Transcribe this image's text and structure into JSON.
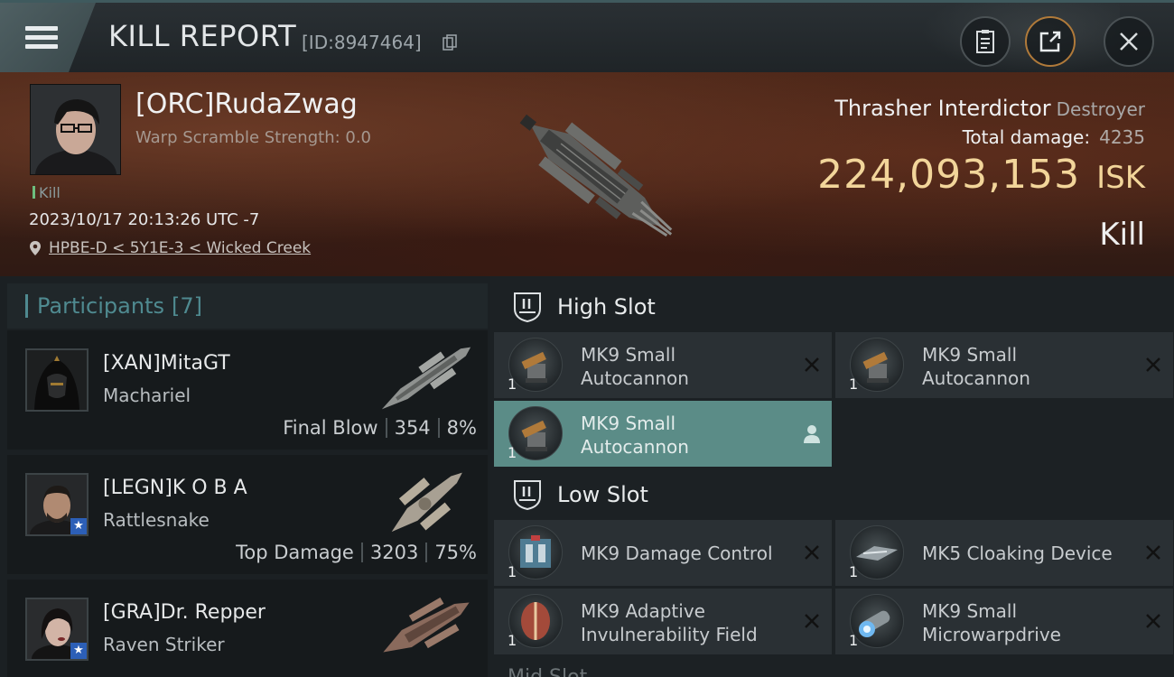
{
  "header": {
    "title": "KILL REPORT",
    "report_id": "[ID:8947464]",
    "icons": [
      "menu-icon",
      "copy-icon",
      "clipboard-icon",
      "share-icon",
      "close-icon"
    ]
  },
  "victim": {
    "pilot": "[ORC]RudaZwag",
    "subtitle": "Warp Scramble Strength: 0.0",
    "tag": "Kill",
    "timestamp": "2023/10/17 20:13:26 UTC -7",
    "location": "HPBE-D < 5Y1E-3 < Wicked Creek",
    "ship": "Thrasher Interdictor",
    "ship_class": "Destroyer",
    "total_damage_label": "Total damage:",
    "total_damage": "4235",
    "isk_value": "224,093,153",
    "isk_unit": "ISK",
    "result": "Kill"
  },
  "participants": {
    "label": "Participants",
    "count": "[7]",
    "list": [
      {
        "name": "[XAN]MitaGT",
        "ship": "Machariel",
        "role": "Final Blow",
        "damage": "354",
        "percent": "8%"
      },
      {
        "name": "[LEGN]K O B A",
        "ship": "Rattlesnake",
        "role": "Top Damage",
        "damage": "3203",
        "percent": "75%"
      },
      {
        "name": "[GRA]Dr. Repper",
        "ship": "Raven Striker",
        "role": "",
        "damage": "",
        "percent": ""
      }
    ]
  },
  "fitting": {
    "high_slot": {
      "label": "High Slot",
      "modules": [
        {
          "name_line1": "MK9 Small",
          "name_line2": "Autocannon",
          "qty": "1",
          "state": "destroyed"
        },
        {
          "name_line1": "MK9 Small",
          "name_line2": "Autocannon",
          "qty": "1",
          "state": "destroyed"
        },
        {
          "name_line1": "MK9 Small",
          "name_line2": "Autocannon",
          "qty": "1",
          "state": "dropped"
        }
      ]
    },
    "low_slot": {
      "label": "Low Slot",
      "modules": [
        {
          "name_line1": "MK9 Damage Control",
          "name_line2": "",
          "qty": "1",
          "state": "destroyed"
        },
        {
          "name_line1": "MK5 Cloaking Device",
          "name_line2": "",
          "qty": "1",
          "state": "destroyed"
        },
        {
          "name_line1": "MK9 Adaptive",
          "name_line2": "Invulnerability Field",
          "qty": "1",
          "state": "destroyed"
        },
        {
          "name_line1": "MK9 Small",
          "name_line2": "Microwarpdrive",
          "qty": "1",
          "state": "destroyed"
        }
      ]
    },
    "mid_slot_peek": "Mid Slot"
  },
  "colors": {
    "accent_teal": "#5b8c87",
    "isk_gold": "#f2d59a",
    "participants_teal": "#4f8a90"
  }
}
